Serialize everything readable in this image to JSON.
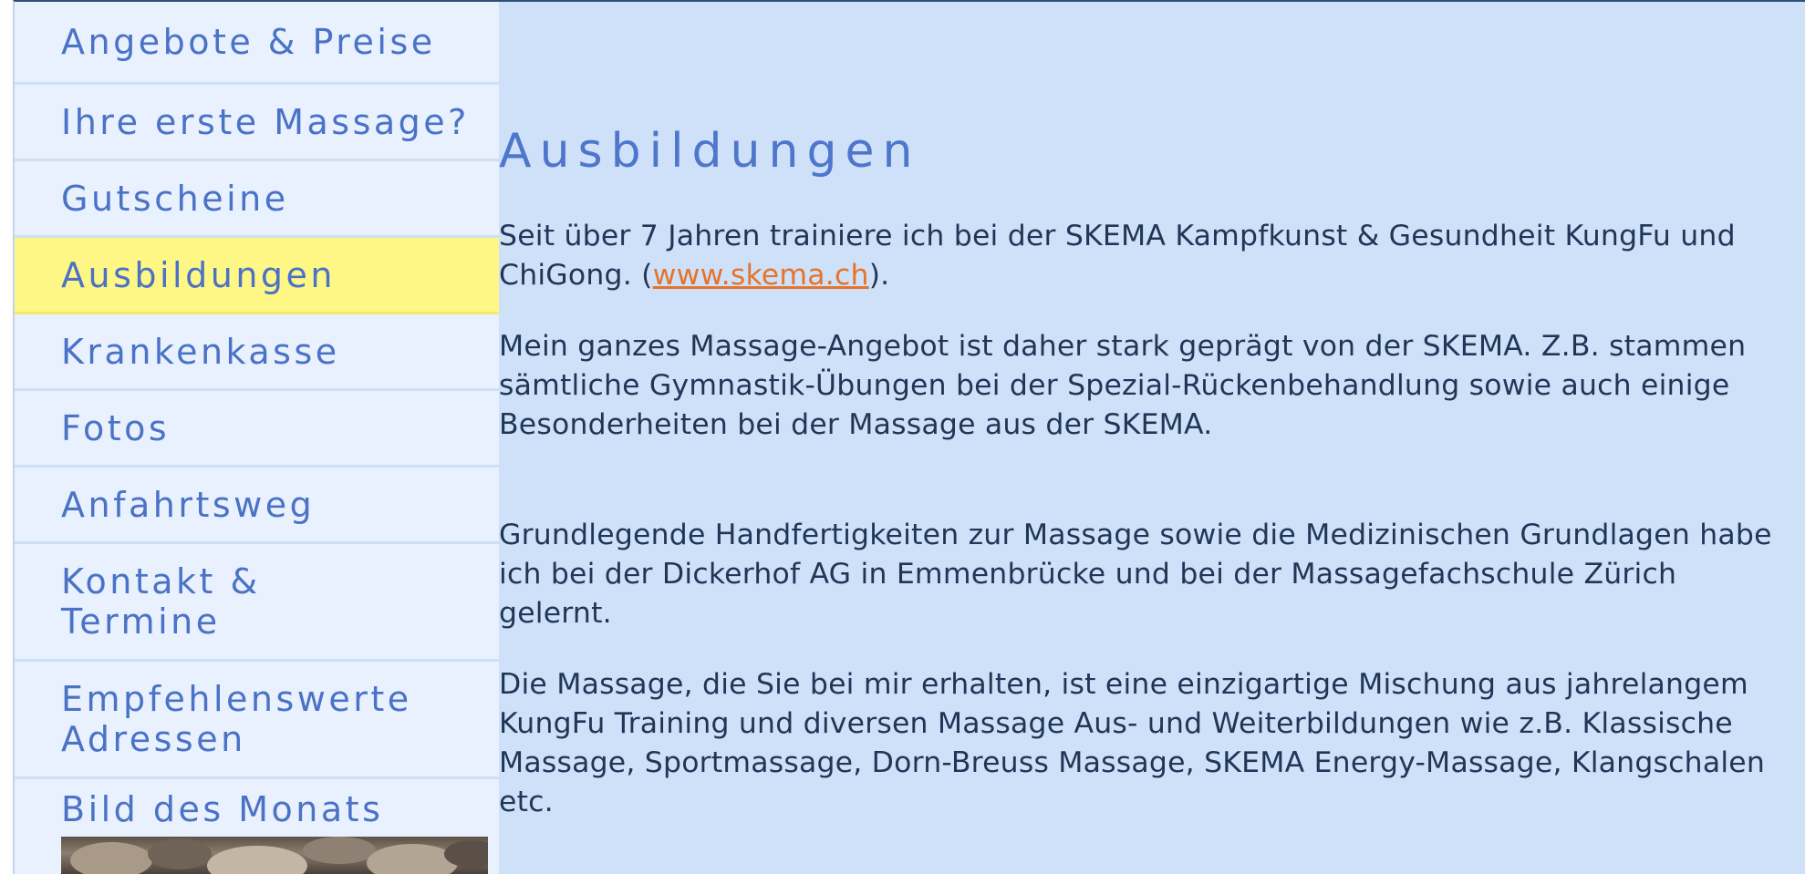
{
  "sidebar": {
    "items": [
      {
        "label": "Angebote & Preise"
      },
      {
        "label": "Ihre erste Massage?"
      },
      {
        "label": "Gutscheine"
      },
      {
        "label": "Ausbildungen"
      },
      {
        "label": "Krankenkasse"
      },
      {
        "label": "Fotos"
      },
      {
        "label": "Anfahrtsweg"
      },
      {
        "label": "Kontakt &\nTermine"
      },
      {
        "label": "Empfehlenswerte\nAdressen"
      }
    ],
    "active_item": "Ausbildungen",
    "bild_des_monats": "Bild des Monats"
  },
  "main": {
    "title": "Ausbildungen",
    "p1_text": "Seit über 7 Jahren trainiere ich bei der SKEMA Kampfkunst & Gesundheit KungFu und ChiGong. (",
    "p1_link": "www.skema.ch",
    "p1_after": ").",
    "p2": "Mein ganzes Massage-Angebot ist daher stark geprägt von der SKEMA. Z.B. stammen sämtliche Gymnastik-Übungen bei der Spezial-Rückenbehandlung sowie auch einige Besonderheiten bei der Massage aus der SKEMA.",
    "p3": "Grundlegende Handfertigkeiten zur Massage sowie die Medizinischen Grundlagen habe ich bei der Dickerhof AG in Emmenbrücke und bei der Massagefachschule Zürich gelernt.",
    "p4": "Die Massage, die Sie bei mir erhalten, ist eine einzigartige Mischung aus jahrelangem KungFu Training und diversen Massage Aus- und Weiterbildungen wie z.B. Klassische Massage, Sportmassage, Dorn-Breuss Massage, SKEMA Energy-Massage, Klangschalen etc."
  },
  "colors": {
    "nav_text": "#4a72c6",
    "active_bg": "#fff785",
    "content_bg": "#cfe1f8",
    "sidebar_bg": "#e8f1fd",
    "link": "#e5742c"
  }
}
